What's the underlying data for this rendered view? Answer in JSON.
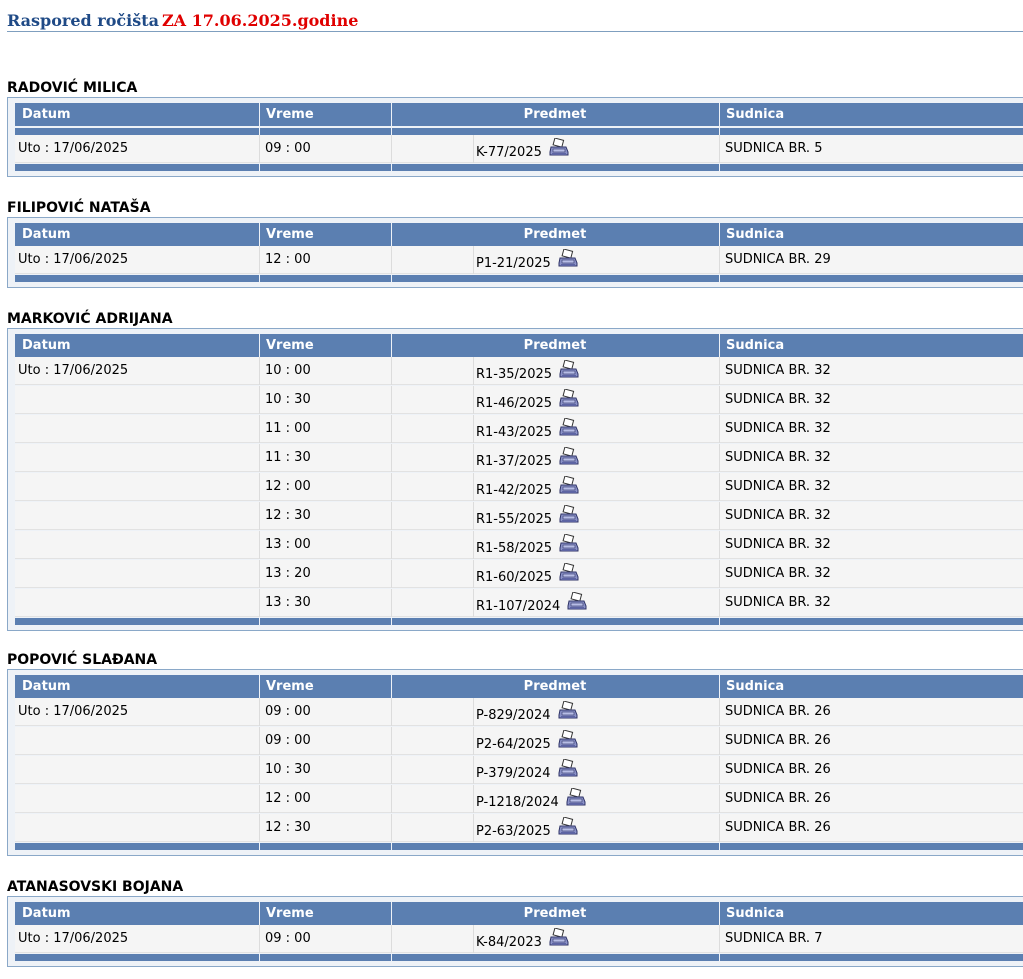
{
  "header": {
    "title": "Raspored ročišta",
    "date_label": "ZA 17.06.2025.godine"
  },
  "columns": {
    "datum": "Datum",
    "vreme": "Vreme",
    "predmet": "Predmet",
    "sudnica": "Sudnica"
  },
  "icons": {
    "case_link": "printer-icon"
  },
  "colors": {
    "title": "#1f4a86",
    "date": "#e00000",
    "header_bg": "#5b7fb1"
  },
  "judges": [
    {
      "name": "RADOVIĆ MILICA",
      "rows": [
        {
          "date": "Uto : 17/06/2025",
          "time": "09 : 00",
          "case": "K-77/2025",
          "room": "SUDNICA BR. 5"
        }
      ]
    },
    {
      "name": "FILIPOVIĆ NATAŠA",
      "rows": [
        {
          "date": "Uto : 17/06/2025",
          "time": "12 : 00",
          "case": "P1-21/2025",
          "room": "SUDNICA BR. 29"
        }
      ]
    },
    {
      "name": "MARKOVIĆ ADRIJANA",
      "rows": [
        {
          "date": "Uto : 17/06/2025",
          "time": "10 : 00",
          "case": "R1-35/2025",
          "room": "SUDNICA BR. 32"
        },
        {
          "date": "",
          "time": "10 : 30",
          "case": "R1-46/2025",
          "room": "SUDNICA BR. 32"
        },
        {
          "date": "",
          "time": "11 : 00",
          "case": "R1-43/2025",
          "room": "SUDNICA BR. 32"
        },
        {
          "date": "",
          "time": "11 : 30",
          "case": "R1-37/2025",
          "room": "SUDNICA BR. 32"
        },
        {
          "date": "",
          "time": "12 : 00",
          "case": "R1-42/2025",
          "room": "SUDNICA BR. 32"
        },
        {
          "date": "",
          "time": "12 : 30",
          "case": "R1-55/2025",
          "room": "SUDNICA BR. 32"
        },
        {
          "date": "",
          "time": "13 : 00",
          "case": "R1-58/2025",
          "room": "SUDNICA BR. 32"
        },
        {
          "date": "",
          "time": "13 : 20",
          "case": "R1-60/2025",
          "room": "SUDNICA BR. 32"
        },
        {
          "date": "",
          "time": "13 : 30",
          "case": "R1-107/2024",
          "room": "SUDNICA BR. 32"
        }
      ]
    },
    {
      "name": "POPOVIĆ SLAĐANA",
      "rows": [
        {
          "date": "Uto : 17/06/2025",
          "time": "09 : 00",
          "case": "P-829/2024",
          "room": "SUDNICA BR. 26"
        },
        {
          "date": "",
          "time": "09 : 00",
          "case": "P2-64/2025",
          "room": "SUDNICA BR. 26"
        },
        {
          "date": "",
          "time": "10 : 30",
          "case": "P-379/2024",
          "room": "SUDNICA BR. 26"
        },
        {
          "date": "",
          "time": "12 : 00",
          "case": "P-1218/2024",
          "room": "SUDNICA BR. 26"
        },
        {
          "date": "",
          "time": "12 : 30",
          "case": "P2-63/2025",
          "room": "SUDNICA BR. 26"
        }
      ]
    },
    {
      "name": "ATANASOVSKI BOJANA",
      "rows": [
        {
          "date": "Uto : 17/06/2025",
          "time": "09 : 00",
          "case": "K-84/2023",
          "room": "SUDNICA BR. 7"
        }
      ]
    }
  ]
}
